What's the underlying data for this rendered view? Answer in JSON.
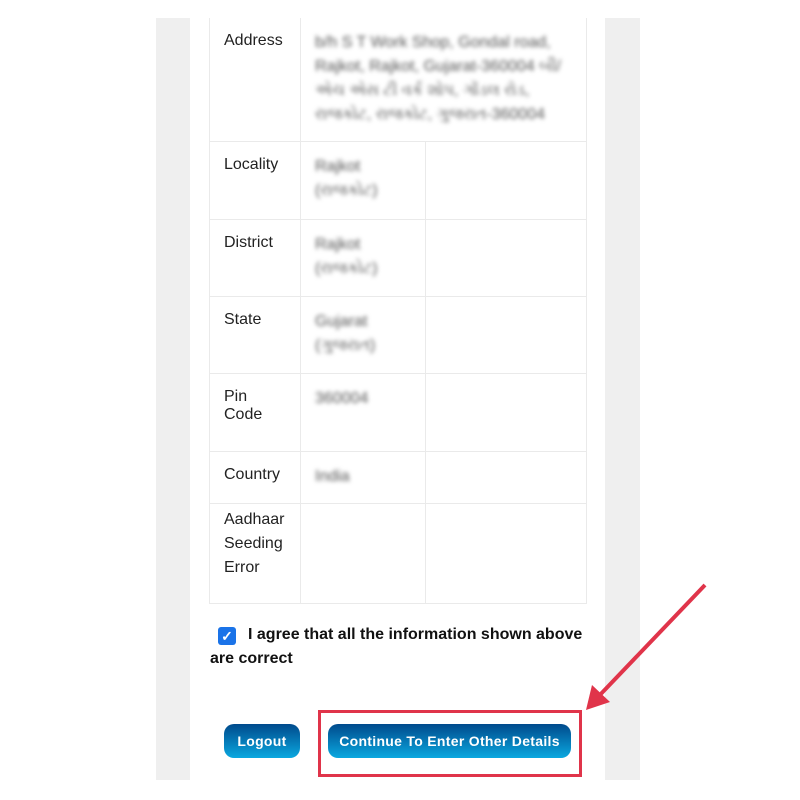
{
  "rows": [
    {
      "label": "Address",
      "value": "b/h S T Work Shop, Gondal road, Rajkot, Rajkot, Gujarat-360004 બી/એચ એસ ટી વર્ક શોપ, ગોંડલ રોડ, રાજકોટ, રાજકોટ, ગુજરાત-360004"
    },
    {
      "label": "Locality",
      "value": "Rajkot (રાજકોટ)"
    },
    {
      "label": "District",
      "value": "Rajkot (રાજકોટ)"
    },
    {
      "label": "State",
      "value": "Gujarat (ગુજરાત)"
    },
    {
      "label": "Pin Code",
      "value": "360004"
    },
    {
      "label": "Country",
      "value": "India"
    },
    {
      "label": "Aadhaar Seeding Error",
      "value": ""
    }
  ],
  "agreement": {
    "checked": true,
    "text": "I agree that all the information shown above are correct"
  },
  "buttons": {
    "logout": "Logout",
    "continue": "Continue To Enter Other Details"
  },
  "annotation_color": "#e0344a"
}
